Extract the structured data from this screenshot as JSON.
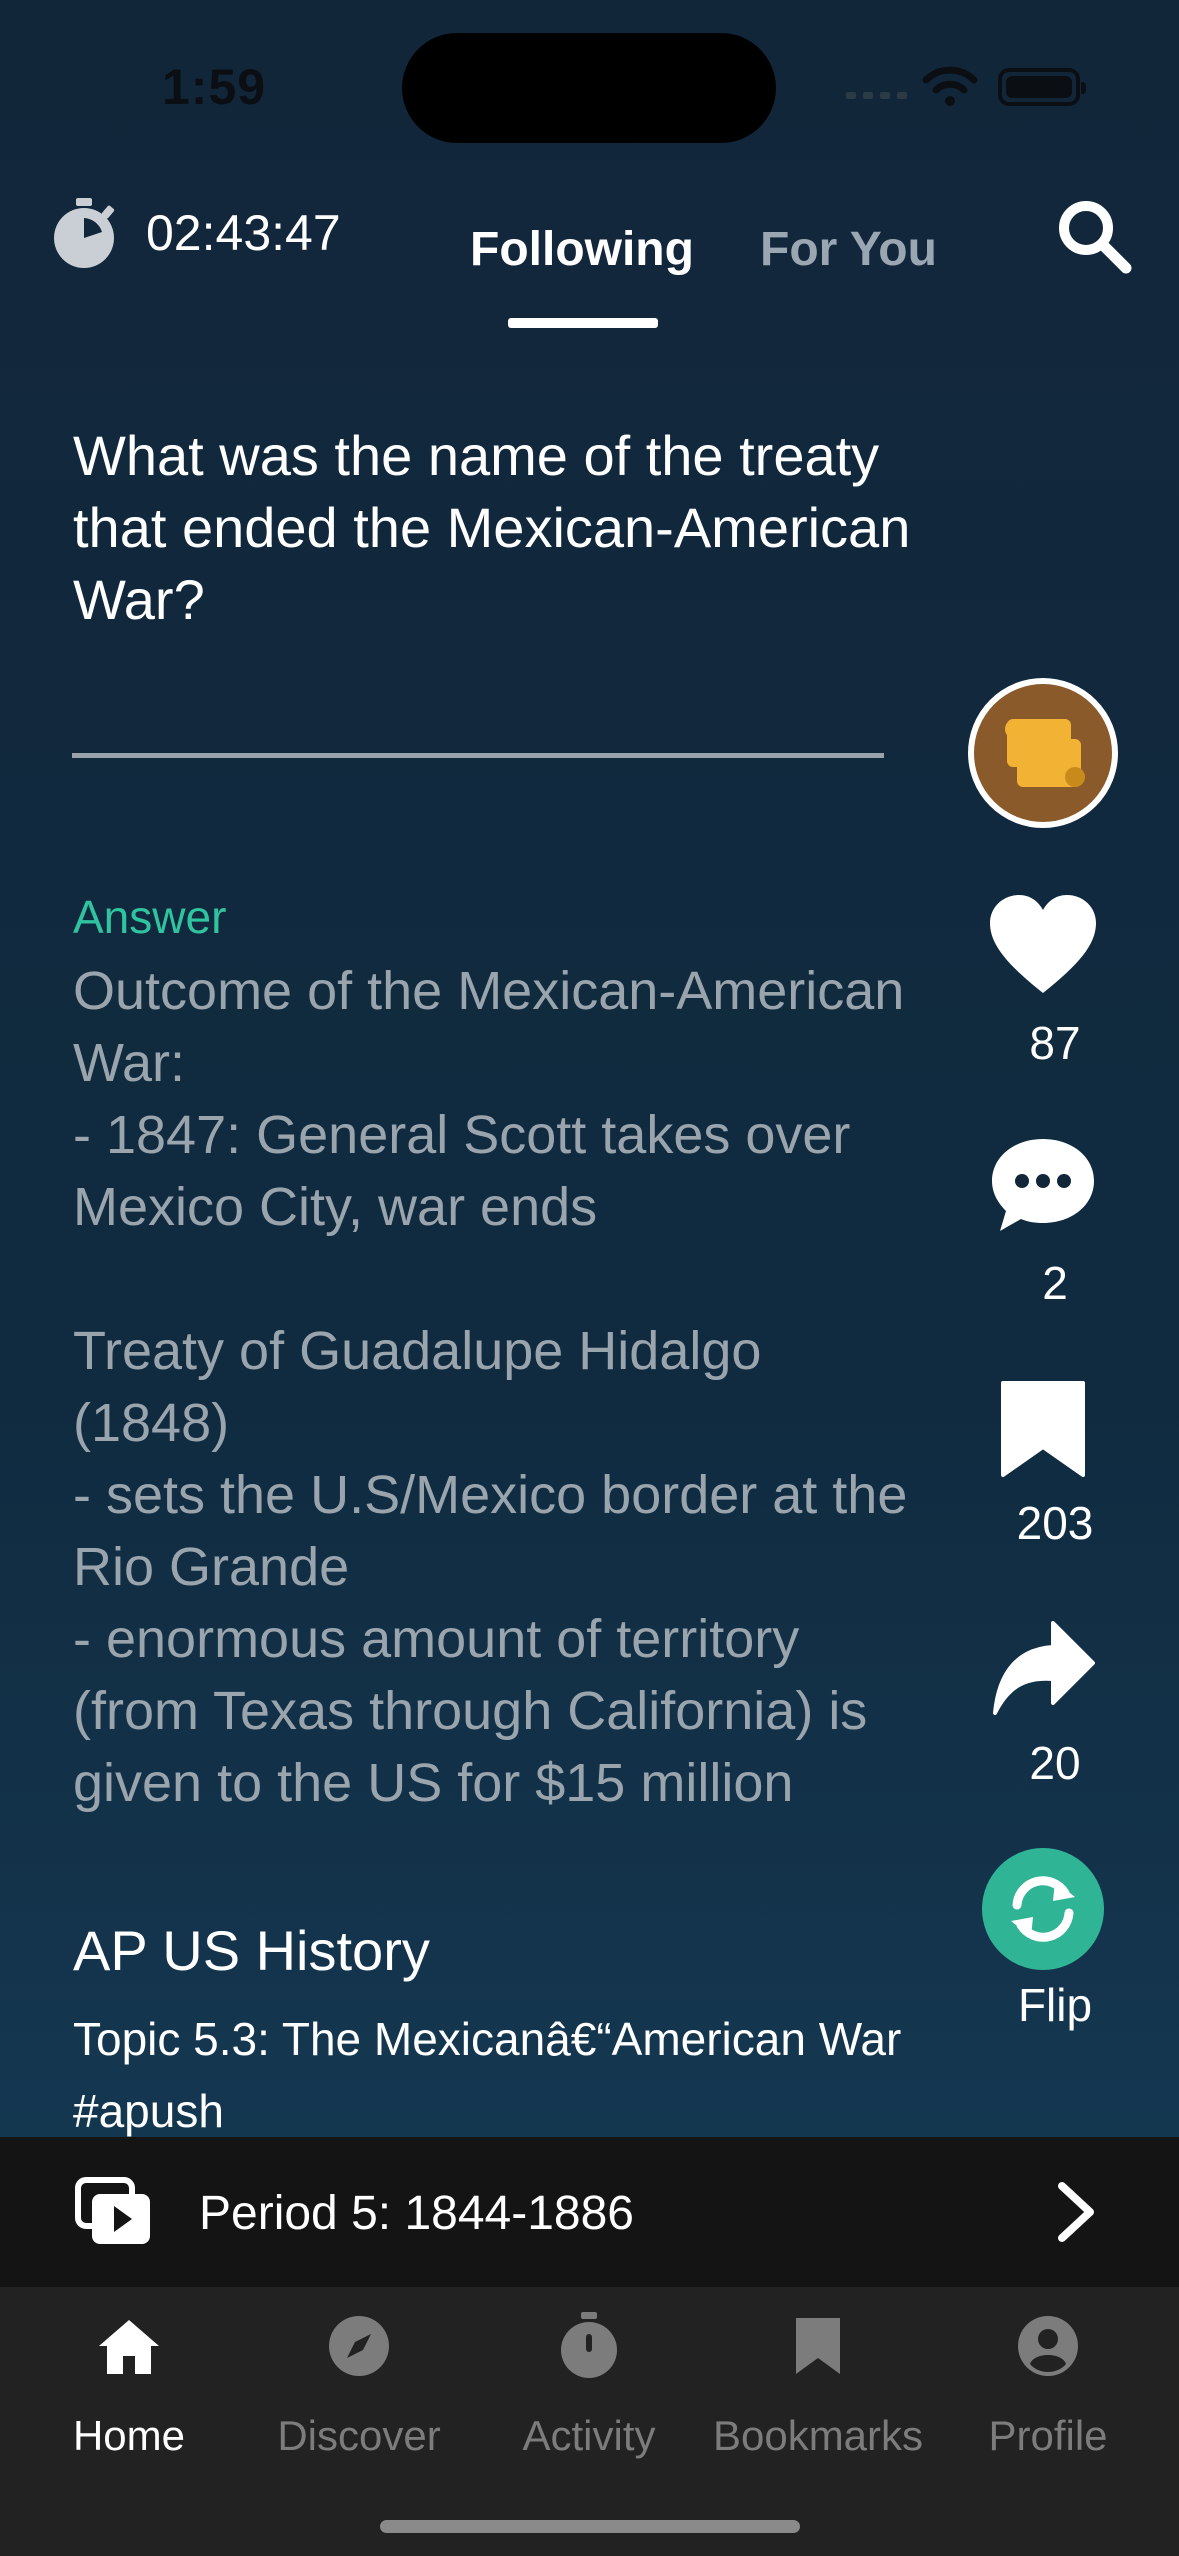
{
  "status_bar": {
    "time": "1:59"
  },
  "header": {
    "timer": "02:43:47",
    "tabs": [
      {
        "label": "Following",
        "active": true
      },
      {
        "label": "For You",
        "active": false
      }
    ]
  },
  "card": {
    "question": "What was the name of the treaty that ended the Mexican-American War?",
    "answer_label": "Answer",
    "answer_text": "Outcome of the Mexican-American War:\n- 1847: General Scott takes over Mexico City, war ends\n\nTreaty of Guadalupe Hidalgo (1848)\n- sets the U.S/Mexico border at the Rio Grande\n- enormous amount of territory (from Texas through California) is given to the US for $15 million",
    "deck_title": "AP US History",
    "topic": "Topic 5.3: The Mexicanâ€“American War #apush"
  },
  "actions": {
    "likes": "87",
    "comments": "2",
    "bookmarks": "203",
    "shares": "20",
    "flip_label": "Flip"
  },
  "deck_bar": {
    "label": "Period 5: 1844-1886"
  },
  "tabbar": {
    "items": [
      {
        "label": "Home",
        "icon": "home-icon",
        "active": true
      },
      {
        "label": "Discover",
        "icon": "compass-icon",
        "active": false
      },
      {
        "label": "Activity",
        "icon": "stopwatch-icon",
        "active": false
      },
      {
        "label": "Bookmarks",
        "icon": "bookmark-icon",
        "active": false
      },
      {
        "label": "Profile",
        "icon": "profile-icon",
        "active": false
      }
    ]
  },
  "colors": {
    "accent": "#2fc49f",
    "flip_button": "#2fb495",
    "avatar_bg": "#8a5a2b",
    "background_top": "#12263a",
    "background_bottom": "#173e5a"
  }
}
